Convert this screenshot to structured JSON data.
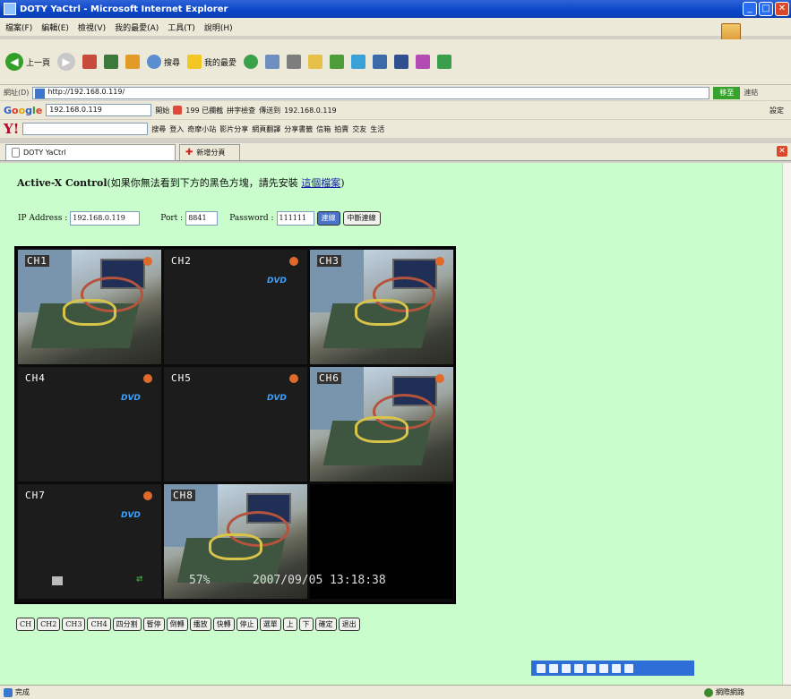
{
  "window": {
    "title": "DOTY YaCtrl - Microsoft Internet Explorer",
    "buttons": [
      "_",
      "□",
      "✕"
    ]
  },
  "menu": [
    "檔案(F)",
    "編輯(E)",
    "檢視(V)",
    "我的最愛(A)",
    "工具(T)",
    "說明(H)"
  ],
  "toolbar": {
    "back_label": "上一頁",
    "search_label": "搜尋",
    "favorites_label": "我的最愛"
  },
  "address": {
    "label": "網址(D)",
    "url": "http://192.168.0.119/",
    "go_label": "移至",
    "links_label": "連結"
  },
  "google": {
    "query": "192.168.0.119",
    "search_label": "開始",
    "result_label": "199 已攔截",
    "spell_label": "拼字檢查",
    "send_label": "傳送到",
    "ip_label": "192.168.0.119",
    "settings_label": "設定"
  },
  "yahoo": {
    "search_label": "搜尋",
    "login_label": "登入",
    "items": [
      "奇摩小站",
      "影片分享",
      "網頁翻譯",
      "分享書籤",
      "信箱",
      "拍賣",
      "交友",
      "生活"
    ]
  },
  "tabs": [
    {
      "label": "DOTY YaCtrl"
    },
    {
      "label": "新增分頁"
    }
  ],
  "page": {
    "heading_bold": "Active-X Control",
    "heading_text": "(如果你無法看到下方的黑色方塊，請先安裝 ",
    "heading_link": "這個檔案",
    "heading_tail": ")",
    "ip_label": "IP Address :",
    "ip_value": "192.168.0.119",
    "port_label": "Port :",
    "port_value": "8841",
    "password_label": "Password :",
    "password_value": "111111",
    "connect_label": "連線",
    "disconnect_label": "中斷連線"
  },
  "dvr": {
    "channels": [
      {
        "label": "CH1",
        "type": "camera"
      },
      {
        "label": "CH2",
        "type": "no-signal"
      },
      {
        "label": "CH3",
        "type": "camera"
      },
      {
        "label": "CH4",
        "type": "no-signal"
      },
      {
        "label": "CH5",
        "type": "no-signal"
      },
      {
        "label": "CH6",
        "type": "camera"
      },
      {
        "label": "CH7",
        "type": "no-signal"
      },
      {
        "label": "CH8",
        "type": "camera"
      }
    ],
    "dvd_logo": "DVD",
    "hdd_percent": "57%",
    "datetime": "2007/09/05 13:18:38"
  },
  "controls": [
    "CH",
    "CH2",
    "CH3",
    "CH4",
    "四分割",
    "暫停",
    "倒轉",
    "播放",
    "快轉",
    "停止",
    "選單",
    "上",
    "下",
    "確定",
    "退出"
  ],
  "statusbar": {
    "left": "完成",
    "zone": "網際網路"
  },
  "colors": {
    "page_bg": "#c9fdcb",
    "title_bar": "#0a46c8",
    "link": "#1a1aa8",
    "rec_dot": "#e06a2c"
  }
}
